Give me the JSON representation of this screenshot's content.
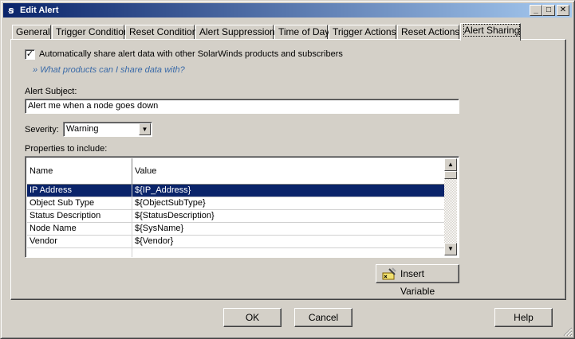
{
  "window": {
    "title": "Edit Alert",
    "app_icon": "solarwinds-app-icon"
  },
  "title_buttons": {
    "minimize": "_",
    "maximize": "□",
    "close": "✕"
  },
  "tabs": [
    {
      "label": "General"
    },
    {
      "label": "Trigger Condition"
    },
    {
      "label": "Reset Condition"
    },
    {
      "label": "Alert Suppression"
    },
    {
      "label": "Time of Day"
    },
    {
      "label": "Trigger Actions"
    },
    {
      "label": "Reset Actions"
    },
    {
      "label": "Alert Sharing",
      "active": true
    }
  ],
  "sharing": {
    "checkbox_checked": true,
    "checkbox_label": "Automatically share alert data with other SolarWinds products and subscribers",
    "help_link": "» What products can I share data with?",
    "subject_label": "Alert Subject:",
    "subject_value": "Alert me when a node goes down",
    "severity_label": "Severity:",
    "severity_value": "Warning",
    "properties_label": "Properties to include:"
  },
  "grid": {
    "columns": [
      "Name",
      "Value"
    ],
    "rows": [
      {
        "name": "IP Address",
        "value": "${IP_Address}",
        "selected": true
      },
      {
        "name": "Object Sub Type",
        "value": "${ObjectSubType}"
      },
      {
        "name": "Status Description",
        "value": "${StatusDescription}"
      },
      {
        "name": "Node Name",
        "value": "${SysName}"
      },
      {
        "name": "Vendor",
        "value": "${Vendor}"
      }
    ]
  },
  "buttons": {
    "insert_variable": "Insert Variable",
    "ok": "OK",
    "cancel": "Cancel",
    "help": "Help"
  }
}
